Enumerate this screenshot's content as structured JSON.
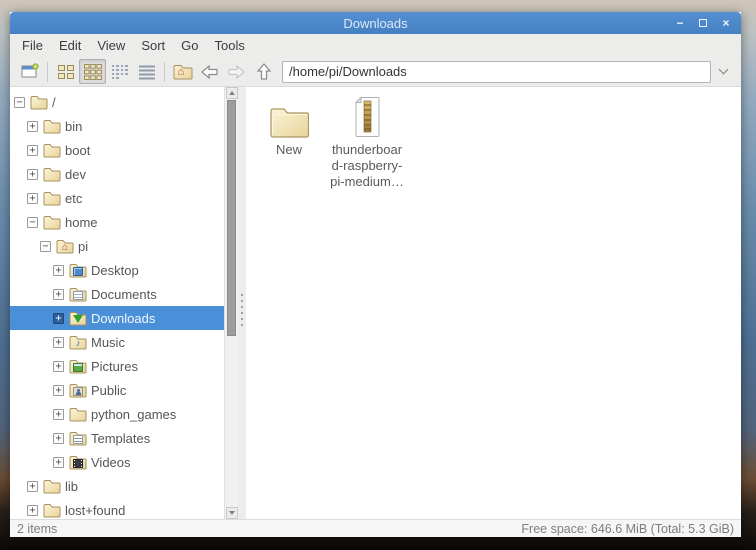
{
  "window": {
    "title": "Downloads",
    "controls": {
      "minimize_glyph": "−",
      "close_glyph": "×"
    },
    "menu": {
      "items": [
        "File",
        "Edit",
        "View",
        "Sort",
        "Go",
        "Tools"
      ]
    },
    "toolbar": {
      "path_value": "/home/pi/Downloads",
      "buttons": [
        {
          "name": "new-window"
        },
        {
          "name": "icon-view"
        },
        {
          "name": "thumbnail-view",
          "active": true
        },
        {
          "name": "compact-view"
        },
        {
          "name": "detailed-view"
        },
        {
          "name": "home"
        },
        {
          "name": "back",
          "enabled": true
        },
        {
          "name": "forward",
          "enabled": false
        },
        {
          "name": "up",
          "enabled": true
        }
      ]
    },
    "sidebar": {
      "items": [
        {
          "label": "/",
          "depth": 0,
          "icon": "folder",
          "expander": "−",
          "selected": false
        },
        {
          "label": "bin",
          "depth": 1,
          "icon": "folder",
          "expander": "+",
          "selected": false
        },
        {
          "label": "boot",
          "depth": 1,
          "icon": "folder",
          "expander": "+",
          "selected": false
        },
        {
          "label": "dev",
          "depth": 1,
          "icon": "folder",
          "expander": "+",
          "selected": false
        },
        {
          "label": "etc",
          "depth": 1,
          "icon": "folder",
          "expander": "+",
          "selected": false
        },
        {
          "label": "home",
          "depth": 1,
          "icon": "folder",
          "expander": "−",
          "selected": false
        },
        {
          "label": "pi",
          "depth": 2,
          "icon": "folder-home",
          "expander": "−",
          "selected": false
        },
        {
          "label": "Desktop",
          "depth": 3,
          "icon": "folder-desktop",
          "expander": "+",
          "selected": false
        },
        {
          "label": "Documents",
          "depth": 3,
          "icon": "folder-documents",
          "expander": "+",
          "selected": false
        },
        {
          "label": "Downloads",
          "depth": 3,
          "icon": "folder-downloads",
          "expander": "+",
          "selected": true
        },
        {
          "label": "Music",
          "depth": 3,
          "icon": "folder-music",
          "expander": "+",
          "selected": false
        },
        {
          "label": "Pictures",
          "depth": 3,
          "icon": "folder-pictures",
          "expander": "+",
          "selected": false
        },
        {
          "label": "Public",
          "depth": 3,
          "icon": "folder-public",
          "expander": "+",
          "selected": false
        },
        {
          "label": "python_games",
          "depth": 3,
          "icon": "folder",
          "expander": "+",
          "selected": false
        },
        {
          "label": "Templates",
          "depth": 3,
          "icon": "folder-templates",
          "expander": "+",
          "selected": false
        },
        {
          "label": "Videos",
          "depth": 3,
          "icon": "folder-videos",
          "expander": "+",
          "selected": false
        },
        {
          "label": "lib",
          "depth": 1,
          "icon": "folder",
          "expander": "+",
          "selected": false
        },
        {
          "label": "lost+found",
          "depth": 1,
          "icon": "folder",
          "expander": "+",
          "selected": false
        }
      ],
      "music_emblem_glyph": "♪",
      "home_emblem_glyph": "⌂"
    },
    "main": {
      "items": [
        {
          "label": "New",
          "icon": "folder"
        },
        {
          "label": "thunderboar\nd-raspberry-\npi-medium…",
          "icon": "image-file"
        }
      ]
    },
    "statusbar": {
      "items_count": "2 items",
      "free_space": "Free space: 646.6 MiB (Total: 5.3 GiB)"
    },
    "colors": {
      "titlebar": "#4a86c8",
      "selection": "#4a90d9",
      "folder": "#f1e6b8"
    }
  }
}
